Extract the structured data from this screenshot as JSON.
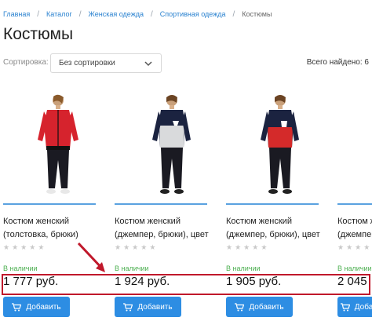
{
  "breadcrumb": {
    "items": [
      "Главная",
      "Каталог",
      "Женская одежда",
      "Спортивная одежда"
    ],
    "current": "Костюмы"
  },
  "page": {
    "title": "Костюмы"
  },
  "toolbar": {
    "sort_label": "Сортировка:",
    "sort_value": "Без сортировки",
    "total": "Всего найдено: 6"
  },
  "products": [
    {
      "name_line1": "Костюм женский",
      "name_line2": "(толстовка, брюки)",
      "stock": "В наличии",
      "price": "1 777 руб.",
      "add_label": "Добавить",
      "rating": 0
    },
    {
      "name_line1": "Костюм женский",
      "name_line2": "(джемпер, брюки), цвет",
      "stock": "В наличии",
      "price": "1 924 руб.",
      "add_label": "Добавить",
      "rating": 0
    },
    {
      "name_line1": "Костюм женский",
      "name_line2": "(джемпер, брюки), цвет",
      "stock": "В наличии",
      "price": "1 905 руб.",
      "add_label": "Добавить",
      "rating": 0
    },
    {
      "name_line1": "Костюм ж",
      "name_line2": "(джемпер",
      "stock": "В наличии",
      "price": "2 045",
      "add_label": "Добави",
      "rating": 0
    }
  ],
  "colors": {
    "accent": "#2d8de3",
    "link": "#2a82d0",
    "in_stock": "#4caf50",
    "highlight": "#c0182b"
  }
}
